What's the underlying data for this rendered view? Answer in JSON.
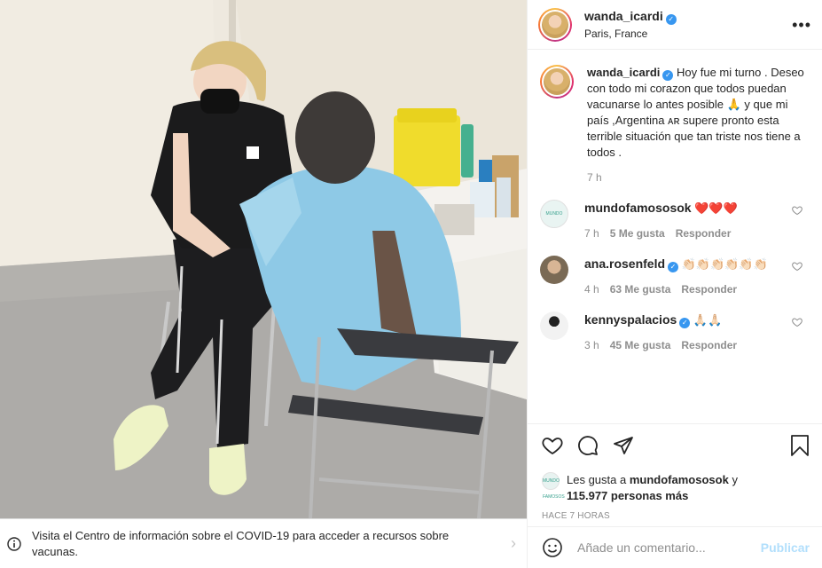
{
  "post": {
    "author": "wanda_icardi",
    "location": "Paris, France",
    "more_icon": "more-horizontal-icon"
  },
  "caption": {
    "username": "wanda_icardi",
    "text": "Hoy fue mi turno . Deseo con todo mi corazon que todos puedan vacunarse lo antes posible 🙏 y que mi país ,Argentina ᴀʀ supere pronto esta terrible situación que tan triste nos tiene a todos .",
    "time": "7 h"
  },
  "comments": [
    {
      "username": "mundofamososok",
      "text": "❤️❤️❤️",
      "time": "7 h",
      "likes": "5 Me gusta",
      "reply": "Responder",
      "verified": false,
      "avatar_color": "#e9f4f2"
    },
    {
      "username": "ana.rosenfeld",
      "text": "👏🏻👏🏻👏🏻👏🏻👏🏻👏🏻",
      "time": "4 h",
      "likes": "63 Me gusta",
      "reply": "Responder",
      "verified": true,
      "avatar_color": "#8a7a64"
    },
    {
      "username": "kennyspalacios",
      "text": "🙏🏻🙏🏻",
      "time": "3 h",
      "likes": "45 Me gusta",
      "reply": "Responder",
      "verified": true,
      "avatar_color": "#dcdcdc"
    }
  ],
  "likes": {
    "prefix": "Les gusta a",
    "first_user": "mundofamososok",
    "connector": "y",
    "others": "115.977 personas más",
    "mini_avatar_text": "MUNDO FAMOSOS"
  },
  "post_time": "HACE 7 HORAS",
  "add_comment": {
    "placeholder": "Añade un comentario...",
    "publish_label": "Publicar"
  },
  "covid_banner": {
    "text": "Visita el Centro de información sobre el COVID-19 para acceder a recursos sobre vacunas."
  },
  "colors": {
    "verified": "#3897f0",
    "publish_disabled": "#b2dffc",
    "meta_gray": "#8e8e8e"
  }
}
